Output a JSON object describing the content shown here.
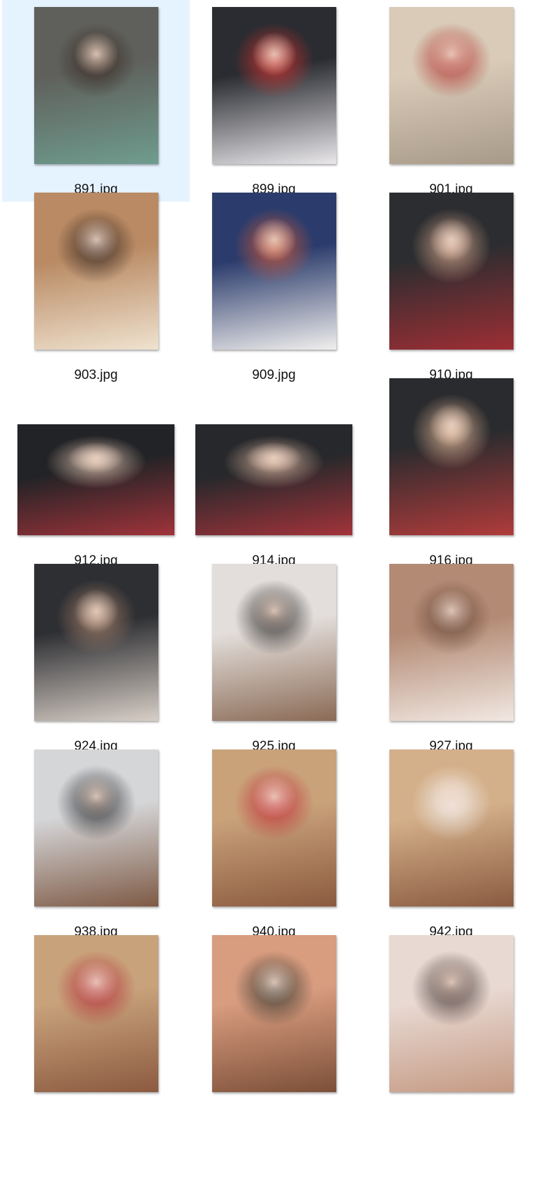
{
  "selected_color": "#e5f3ff",
  "files": [
    {
      "name": "891.jpg",
      "selected": true,
      "orientation": "portrait",
      "palette": [
        "#5f605c",
        "#6f9c8e",
        "#3a2c24"
      ]
    },
    {
      "name": "899.jpg",
      "selected": false,
      "orientation": "portrait",
      "palette": [
        "#2a2c31",
        "#e9e7ea",
        "#c7302e"
      ]
    },
    {
      "name": "901.jpg",
      "selected": false,
      "orientation": "portrait",
      "palette": [
        "#d9cbb8",
        "#a89a88",
        "#b23a35"
      ]
    },
    {
      "name": "903.jpg",
      "selected": false,
      "orientation": "portrait",
      "palette": [
        "#b98a63",
        "#efe2cf",
        "#3a2a22"
      ]
    },
    {
      "name": "909.jpg",
      "selected": false,
      "orientation": "portrait",
      "palette": [
        "#2b3c6c",
        "#f1efee",
        "#c4553a"
      ]
    },
    {
      "name": "910.jpg",
      "selected": false,
      "orientation": "portrait",
      "palette": [
        "#2c2d30",
        "#9d2e34",
        "#c49a82"
      ]
    },
    {
      "name": "912.jpg",
      "selected": false,
      "orientation": "landscape",
      "palette": [
        "#222326",
        "#a0333a",
        "#cdb3a2"
      ]
    },
    {
      "name": "914.jpg",
      "selected": false,
      "orientation": "landscape",
      "palette": [
        "#27282b",
        "#a2333a",
        "#c7a592"
      ]
    },
    {
      "name": "916.jpg",
      "selected": false,
      "orientation": "portrait",
      "palette": [
        "#2a2b2e",
        "#b13b3b",
        "#d0a98c"
      ]
    },
    {
      "name": "924.jpg",
      "selected": false,
      "orientation": "portrait",
      "palette": [
        "#2e2f33",
        "#d8cfc7",
        "#9c7a66"
      ]
    },
    {
      "name": "925.jpg",
      "selected": false,
      "orientation": "portrait",
      "palette": [
        "#e3dedb",
        "#8a6a55",
        "#2f2d2d"
      ]
    },
    {
      "name": "927.jpg",
      "selected": false,
      "orientation": "portrait",
      "palette": [
        "#b38a74",
        "#f1e8e2",
        "#6b4a3b"
      ]
    },
    {
      "name": "938.jpg",
      "selected": false,
      "orientation": "portrait",
      "palette": [
        "#d5d6d8",
        "#7e5a45",
        "#2d2f33"
      ]
    },
    {
      "name": "940.jpg",
      "selected": false,
      "orientation": "portrait",
      "palette": [
        "#c9a27a",
        "#8b5a3f",
        "#c2323b"
      ]
    },
    {
      "name": "942.jpg",
      "selected": false,
      "orientation": "portrait",
      "palette": [
        "#d4b08a",
        "#8a5a40",
        "#efe9e6"
      ]
    },
    {
      "name": "",
      "selected": false,
      "orientation": "portrait",
      "palette": [
        "#c8a27b",
        "#8c5a40",
        "#b5323b"
      ]
    },
    {
      "name": "",
      "selected": false,
      "orientation": "portrait",
      "palette": [
        "#d89c7f",
        "#7c4f38",
        "#3c3b32"
      ]
    },
    {
      "name": "",
      "selected": false,
      "orientation": "portrait",
      "palette": [
        "#e8d9d2",
        "#c59a84",
        "#4a3b38"
      ]
    }
  ]
}
